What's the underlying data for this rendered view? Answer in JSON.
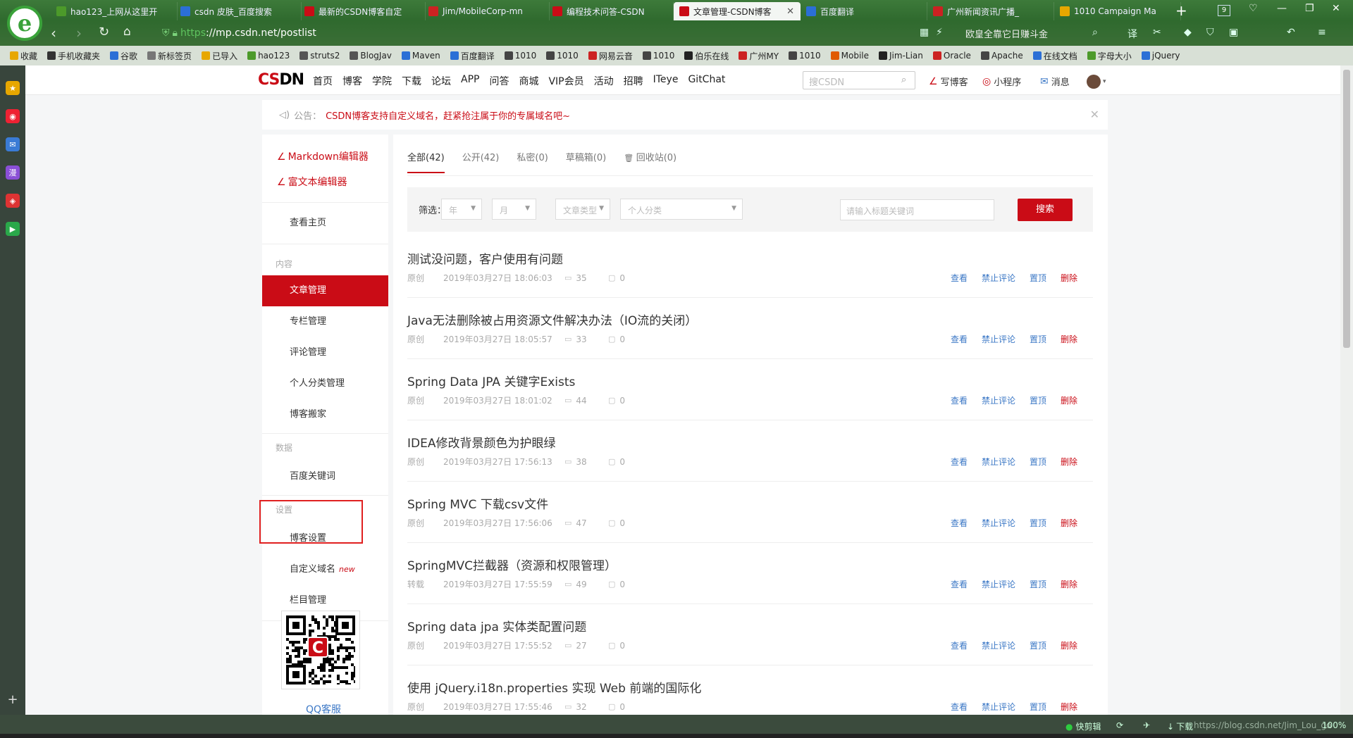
{
  "browser": {
    "tabs": [
      {
        "title": "hao123_上网从这里开",
        "color": "#4c9a2a"
      },
      {
        "title": "csdn 皮肤_百度搜索",
        "color": "#2b6fd6"
      },
      {
        "title": "最新的CSDN博客自定",
        "color": "#ca0c16"
      },
      {
        "title": "Jim/MobileCorp-mn",
        "color": "#c22"
      },
      {
        "title": "编程技术问答-CSDN",
        "color": "#ca0c16"
      },
      {
        "title": "文章管理-CSDN博客",
        "color": "#ca0c16"
      },
      {
        "title": "百度翻译",
        "color": "#2b6fd6"
      },
      {
        "title": "广州新闻资讯广播_",
        "color": "#c22"
      },
      {
        "title": "1010 Campaign Ma",
        "color": "#e6a700"
      }
    ],
    "tab_count": "9",
    "url": "://mp.csdn.net/postlist",
    "url_scheme": "https",
    "addr_search_text": "欧皇全靠它日赚斗金",
    "bookmarks": [
      "收藏",
      "手机收藏夹",
      "谷歌",
      "新标签页",
      "已导入",
      "hao123",
      "struts2",
      "BlogJav",
      "Maven",
      "百度翻译",
      "1010",
      "1010",
      "网易云音",
      "1010",
      "伯乐在线",
      "广州MY",
      "1010",
      "Mobile",
      "Jim-Lian",
      "Oracle",
      "Apache",
      "在线文档",
      "字母大小",
      "jQuery"
    ]
  },
  "header": {
    "logo_cs": "CS",
    "logo_dn": "DN",
    "nav": [
      "首页",
      "博客",
      "学院",
      "下载",
      "论坛",
      "APP",
      "问答",
      "商城",
      "VIP会员",
      "活动",
      "招聘",
      "ITeye",
      "GitChat"
    ],
    "search_placeholder": "搜CSDN",
    "write_blog": "写博客",
    "mini_program": "小程序",
    "messages": "消息"
  },
  "notice": {
    "label": "公告：",
    "text": "CSDN博客支持自定义域名，赶紧抢注属于你的专属域名吧~"
  },
  "sidebar": {
    "markdown_editor": "Markdown编辑器",
    "richtext_editor": "富文本编辑器",
    "home": "查看主页",
    "section_content": "内容",
    "article_mgmt": "文章管理",
    "column_mgmt": "专栏管理",
    "comment_mgmt": "评论管理",
    "category_mgmt": "个人分类管理",
    "blog_move": "博客搬家",
    "section_data": "数据",
    "baidu_keywords": "百度关键词",
    "section_settings": "设置",
    "blog_settings": "博客设置",
    "custom_domain": "自定义域名",
    "new_badge": "new",
    "column_manage": "栏目管理",
    "qq_service": "QQ客服"
  },
  "content": {
    "tabs": [
      "全部(42)",
      "公开(42)",
      "私密(0)",
      "草稿箱(0)",
      "回收站(0)"
    ],
    "filter_label": "筛选：",
    "filter_year": "年",
    "filter_month": "月",
    "filter_type": "文章类型",
    "filter_category": "个人分类",
    "keyword_placeholder": "请输入标题关键词",
    "search_button": "搜索",
    "actions": {
      "view": "查看",
      "disable_comment": "禁止评论",
      "top": "置顶",
      "delete": "删除"
    },
    "articles": [
      {
        "title": "测试没问题，客户使用有问题",
        "type": "原创",
        "date": "2019年03月27日 18:06:03",
        "views": "35",
        "comments": "0"
      },
      {
        "title": "Java无法删除被占用资源文件解决办法（IO流的关闭）",
        "type": "原创",
        "date": "2019年03月27日 18:05:57",
        "views": "33",
        "comments": "0"
      },
      {
        "title": "Spring Data JPA 关键字Exists",
        "type": "原创",
        "date": "2019年03月27日 18:01:02",
        "views": "44",
        "comments": "0"
      },
      {
        "title": "IDEA修改背景颜色为护眼绿",
        "type": "原创",
        "date": "2019年03月27日 17:56:13",
        "views": "38",
        "comments": "0"
      },
      {
        "title": "Spring MVC 下载csv文件",
        "type": "原创",
        "date": "2019年03月27日 17:56:06",
        "views": "47",
        "comments": "0"
      },
      {
        "title": "SpringMVC拦截器（资源和权限管理）",
        "type": "转载",
        "date": "2019年03月27日 17:55:59",
        "views": "49",
        "comments": "0"
      },
      {
        "title": "Spring data jpa 实体类配置问题",
        "type": "原创",
        "date": "2019年03月27日 17:55:52",
        "views": "27",
        "comments": "0"
      },
      {
        "title": "使用 jQuery.i18n.properties 实现 Web 前端的国际化",
        "type": "原创",
        "date": "2019年03月27日 17:55:46",
        "views": "32",
        "comments": "0"
      }
    ]
  },
  "statusbar": {
    "quick_cut": "快剪辑",
    "download": "下载",
    "watermark": "https://blog.csdn.net/Jim_Lou_go",
    "zoom": "100%"
  },
  "colors": {
    "brand_red": "#ca0c16",
    "link_blue": "#3c78c6",
    "highlight": "#e02020"
  }
}
